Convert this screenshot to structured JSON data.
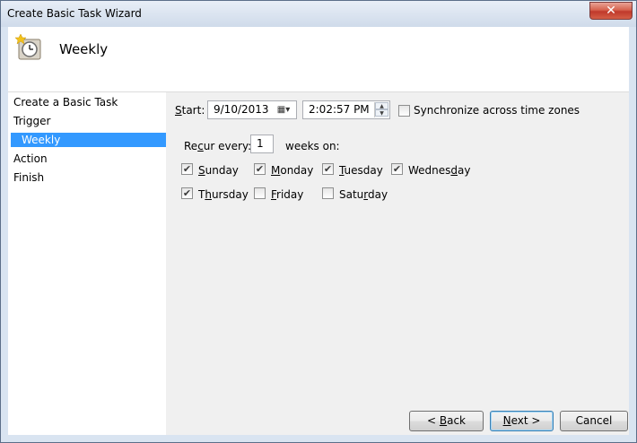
{
  "window": {
    "title": "Create Basic Task Wizard",
    "close_glyph": "✕"
  },
  "header": {
    "title": "Weekly",
    "icon": "clock-icon"
  },
  "nav": {
    "items": [
      {
        "label": "Create a Basic Task",
        "selected": false
      },
      {
        "label": "Trigger",
        "selected": false
      },
      {
        "label": "Weekly",
        "selected": true
      },
      {
        "label": "Action",
        "selected": false
      },
      {
        "label": "Finish",
        "selected": false
      }
    ]
  },
  "start": {
    "label": "Start:",
    "date_value": "9/10/2013",
    "time_value": "2:02:57 PM",
    "sync_label": "Synchronize across time zones",
    "sync_checked": false
  },
  "recur": {
    "label": "Recur every:",
    "value": "1",
    "suffix": "weeks on:"
  },
  "days": [
    {
      "label": "Sunday",
      "checked": true
    },
    {
      "label": "Monday",
      "checked": true
    },
    {
      "label": "Tuesday",
      "checked": true
    },
    {
      "label": "Wednesday",
      "checked": true
    },
    {
      "label": "Thursday",
      "checked": true
    },
    {
      "label": "Friday",
      "checked": false
    },
    {
      "label": "Saturday",
      "checked": false
    }
  ],
  "buttons": {
    "back": "< Back",
    "next": "Next >",
    "cancel": "Cancel"
  },
  "colors": {
    "selection": "#3399ff",
    "content_bg": "#f0f0f0",
    "close_red": "#c0392b"
  }
}
